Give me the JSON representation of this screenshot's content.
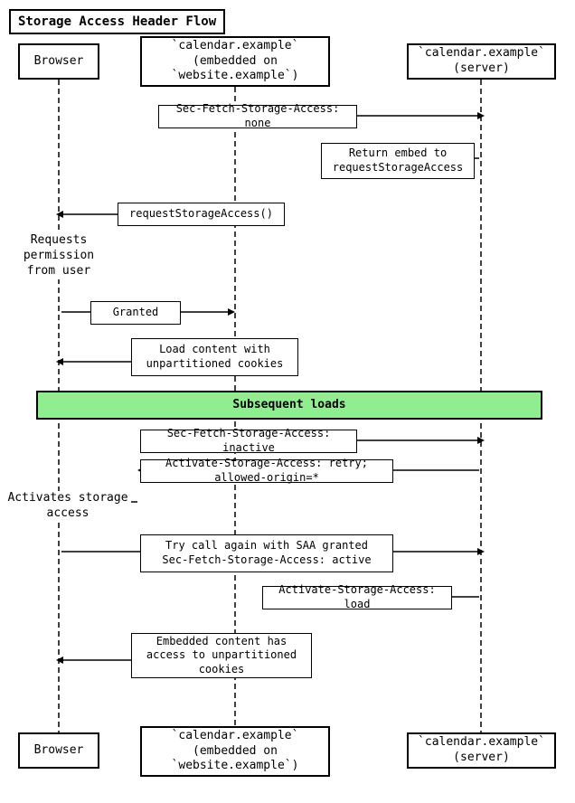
{
  "title": "Storage Access Header Flow",
  "actors": {
    "browser_top": "Browser",
    "embed_top": "`calendar.example`\n(embedded on `website.example`)",
    "server_top": "`calendar.example`\n(server)",
    "browser_bottom": "Browser",
    "embed_bottom": "`calendar.example`\n(embedded on `website.example`)",
    "server_bottom": "`calendar.example`\n(server)"
  },
  "messages": {
    "msg1": "Sec-Fetch-Storage-Access: none",
    "msg2": "Return embed to\nrequestStorageAccess",
    "msg3": "requestStorageAccess()",
    "msg4": "Requests permission\nfrom user",
    "msg5": "Granted",
    "msg6": "Load content with\nunpartitioned cookies",
    "msg7": "Subsequent loads",
    "msg8": "Sec-Fetch-Storage-Access: inactive",
    "msg9": "Activate-Storage-Access: retry; allowed-origin=*",
    "msg10": "Activates storage access",
    "msg11": "Try call again with SAA granted\nSec-Fetch-Storage-Access: active",
    "msg12": "Activate-Storage-Access: load",
    "msg13": "Embedded content has\naccess to unpartitioned cookies"
  }
}
